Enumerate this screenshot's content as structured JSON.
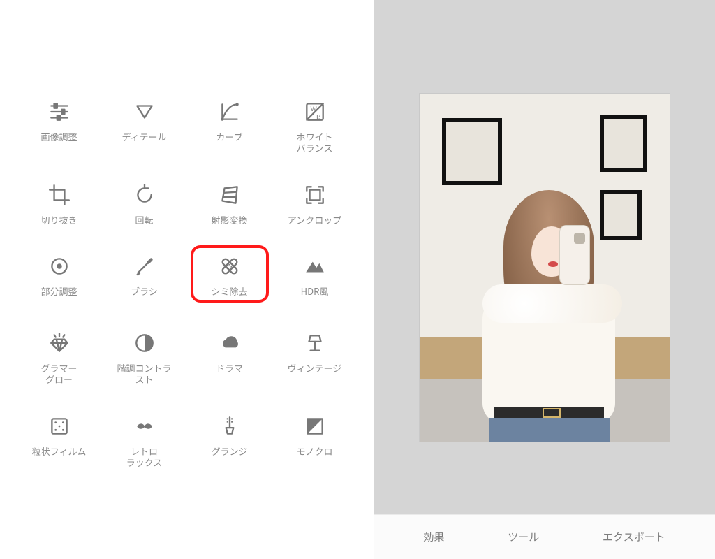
{
  "tools": [
    {
      "id": "tune",
      "label": "画像調整",
      "icon": "tune"
    },
    {
      "id": "detail",
      "label": "ディテール",
      "icon": "triangle-down"
    },
    {
      "id": "curve",
      "label": "カーブ",
      "icon": "curve"
    },
    {
      "id": "white-balance",
      "label": "ホワイト\nバランス",
      "icon": "wb"
    },
    {
      "id": "crop",
      "label": "切り抜き",
      "icon": "crop"
    },
    {
      "id": "rotate",
      "label": "回転",
      "icon": "rotate"
    },
    {
      "id": "perspective",
      "label": "射影変換",
      "icon": "perspective"
    },
    {
      "id": "uncrop",
      "label": "アンクロップ",
      "icon": "uncrop"
    },
    {
      "id": "selective",
      "label": "部分調整",
      "icon": "target"
    },
    {
      "id": "brush",
      "label": "ブラシ",
      "icon": "brush"
    },
    {
      "id": "healing",
      "label": "シミ除去",
      "icon": "bandage",
      "highlighted": true
    },
    {
      "id": "hdr",
      "label": "HDR風",
      "icon": "mountain"
    },
    {
      "id": "glamour",
      "label": "グラマー\nグロー",
      "icon": "diamond"
    },
    {
      "id": "tonal",
      "label": "階調コントラ\nスト",
      "icon": "half-circle"
    },
    {
      "id": "drama",
      "label": "ドラマ",
      "icon": "cloud"
    },
    {
      "id": "vintage",
      "label": "ヴィンテージ",
      "icon": "lamp"
    },
    {
      "id": "grainy",
      "label": "粒状フィルム",
      "icon": "film-grain"
    },
    {
      "id": "retrolux",
      "label": "レトロ\nラックス",
      "icon": "mustache"
    },
    {
      "id": "grunge",
      "label": "グランジ",
      "icon": "guitar"
    },
    {
      "id": "mono",
      "label": "モノクロ",
      "icon": "mono"
    }
  ],
  "bottom_bar": {
    "effects": "効果",
    "tools": "ツール",
    "export": "エクスポート"
  },
  "preview": {
    "description": "若い女性が白いファー付きトップスとジーンズを着て、スマートフォンで鏡越しに自撮りをしている写真"
  }
}
